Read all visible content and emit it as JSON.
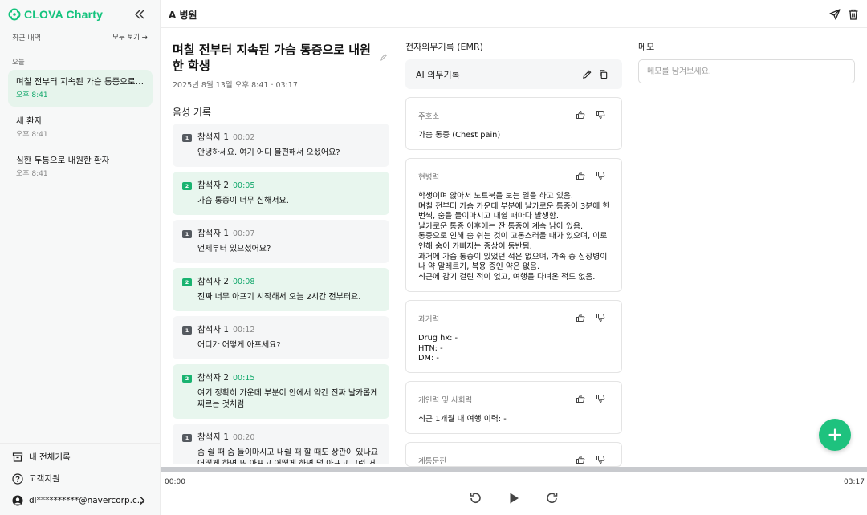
{
  "app": {
    "brand": "CLOVA Charty",
    "brand_color": "#13c37d"
  },
  "sidebar": {
    "recent_label": "최근 내역",
    "see_all": "모두 보기 →",
    "section_today": "오늘",
    "items": [
      {
        "title": "며칠 전부터 지속된 가슴 통증으로 내원한 환자",
        "time": "오후 8:41",
        "active": true
      },
      {
        "title": "새 환자",
        "time": "오후 8:41",
        "active": false
      },
      {
        "title": "심한 두통으로 내원한 환자",
        "time": "오후 8:41",
        "active": false
      }
    ],
    "bottom": {
      "all_records": "내 전체기록",
      "support": "고객지원",
      "user": "dl**********@navercorp.c..."
    }
  },
  "header": {
    "title": "A 병원"
  },
  "record": {
    "title": "며칠 전부터 지속된 가슴 통증으로 내원한 학생",
    "date": "2025년 8월 13일 오후 8:41 · 03:17",
    "voice_label": "음성 기록"
  },
  "transcript": [
    {
      "speaker": "참석자 1",
      "badge": "1",
      "time": "00:02",
      "text": "안녕하세요. 여기 어디 불편해서 오셨어요?"
    },
    {
      "speaker": "참석자 2",
      "badge": "2",
      "time": "00:05",
      "text": "가슴 통증이 너무 심해서요."
    },
    {
      "speaker": "참석자 1",
      "badge": "1",
      "time": "00:07",
      "text": "언제부터 있으셨어요?"
    },
    {
      "speaker": "참석자 2",
      "badge": "2",
      "time": "00:08",
      "text": "진짜 너무 아프기 시작해서 오늘 2시간 전부터요."
    },
    {
      "speaker": "참석자 1",
      "badge": "1",
      "time": "00:12",
      "text": "어디가 어떻게 아프세요?"
    },
    {
      "speaker": "참석자 2",
      "badge": "2",
      "time": "00:15",
      "text": "여기 정확히 가운데 부분이 안에서 약간 진짜 날카롭게 찌르는 것처럼"
    },
    {
      "speaker": "참석자 1",
      "badge": "1",
      "time": "00:20",
      "text": "숨 쉴 때 숨 들이마시고 내쉴 때 할 때도 상관이 있나요 어떻게 하면 또 아프고 어떻게 하면 덜 아프고 그런 거요"
    }
  ],
  "emr": {
    "label": "전자의무기록 (EMR)",
    "ai_title": "AI 의무기록",
    "sections": [
      {
        "title": "주호소",
        "body": "가슴 통증 (Chest pain)"
      },
      {
        "title": "현병력",
        "body": "학생이며 앉아서 노트북을 보는 일을 하고 있음.\n며칠 전부터 가슴 가운데 부분에 날카로운 통증이 3분에 한번씩, 숨을 들이마시고 내쉴 때마다 발생함.\n날카로운 통증 이후에는 잔 통증이 계속 남아 있음.\n통증으로 인해 숨 쉬는 것이 고통스러울 때가 있으며, 이로 인해 숨이 가빠지는 증상이 동반됨.\n과거에 가슴 통증이 있었던 적은 없으며, 가족 중 심장병이나 약 알레르기, 복용 중인 약은 없음.\n최근에 감기 걸린 적이 없고, 여행을 다녀온 적도 없음."
      },
      {
        "title": "과거력",
        "body": "Drug hx: -\nHTN: -\nDM: -"
      },
      {
        "title": "개인력 및 사회력",
        "body": "최근 1개월 내 여행 이력: -"
      },
      {
        "title": "계통문진",
        "body": ""
      }
    ]
  },
  "memo": {
    "label": "메모",
    "placeholder": "메모를 남겨보세요."
  },
  "player": {
    "current": "00:00",
    "total": "03:17",
    "progress": 0.0
  }
}
